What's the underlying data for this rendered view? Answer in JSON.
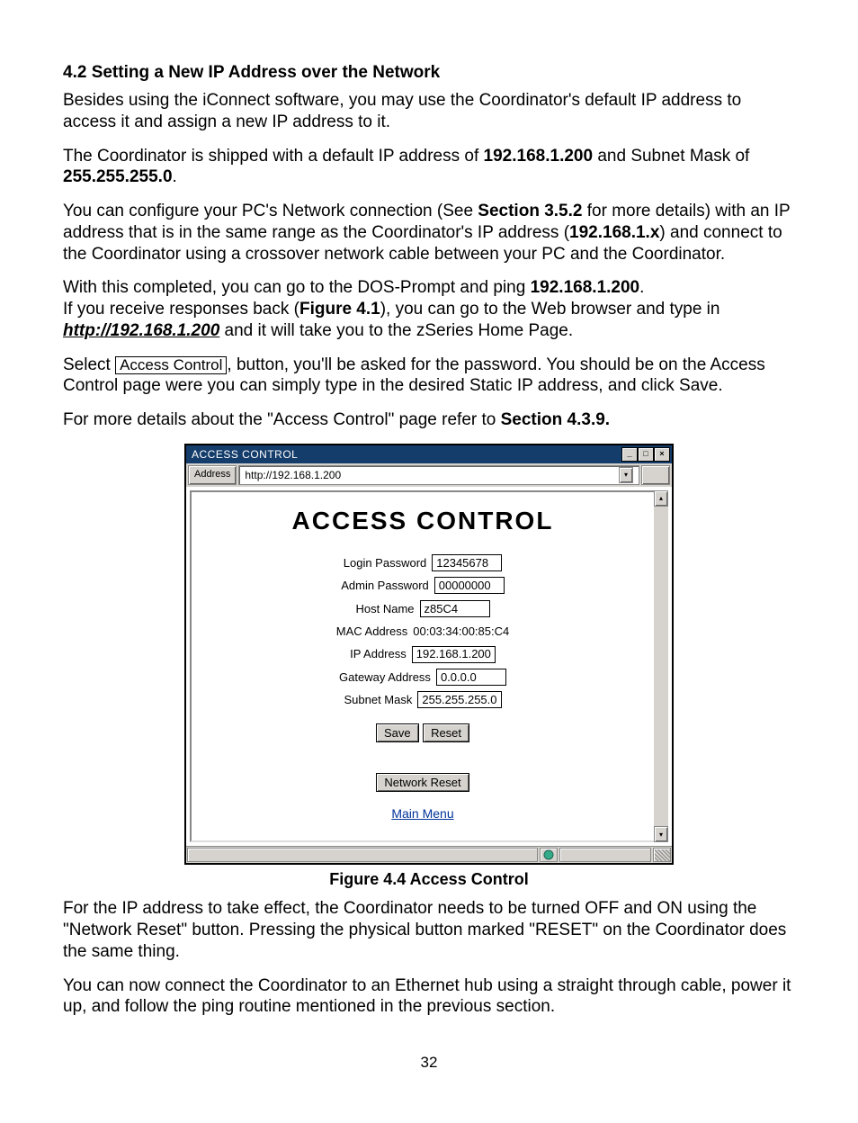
{
  "section_heading": "4.2 Setting a New IP Address over the Network",
  "para1": "Besides using the iConnect software, you may use the Coordinator's default IP address to access it and assign a new IP address to it.",
  "para2_pre": "The Coordinator is shipped with a default IP address of ",
  "para2_ip": "192.168.1.200",
  "para2_mid": " and Subnet Mask of ",
  "para2_mask": "255.255.255.0",
  "para2_end": ".",
  "para3_pre": "You can configure your PC's Network connection (See ",
  "para3_sec": "Section 3.5.2",
  "para3_mid": " for more details) with an IP address that is in the same range as the Coordinator's IP address (",
  "para3_range": "192.168.1.x",
  "para3_end": ") and connect to the Coordinator using a crossover network cable between your PC and the Coordinator.",
  "para4_line1_pre": "With this completed, you can go to the DOS-Prompt and ping ",
  "para4_line1_ip": "192.168.1.200",
  "para4_line1_end": ".",
  "para4_line2_pre": "If you receive responses back (",
  "para4_line2_fig": "Figure 4.1",
  "para4_line2_mid": "), you can go to the Web browser and type in ",
  "para4_url": "http://192.168.1.200",
  "para4_line2_end": " and it will take you to the zSeries Home Page.",
  "para5_pre": "Select  ",
  "para5_btn": "Access Control",
  "para5_post": ", button, you'll be asked for the password. You should be on the Access Control page were you can simply type in the desired Static IP address, and click Save.",
  "para6_pre": "For more details about the \"Access Control\" page refer to ",
  "para6_sec": "Section 4.3.9.",
  "window": {
    "title": "ACCESS CONTROL",
    "address_label": "Address",
    "address_value": "http://192.168.1.200",
    "heading": "ACCESS CONTROL",
    "fields": {
      "login_pw_label": "Login Password",
      "login_pw_value": "12345678",
      "admin_pw_label": "Admin Password",
      "admin_pw_value": "00000000",
      "host_label": "Host Name",
      "host_value": "z85C4",
      "mac_label": "MAC Address",
      "mac_value": "00:03:34:00:85:C4",
      "ip_label": "IP Address",
      "ip_value": "192.168.1.200",
      "gw_label": "Gateway Address",
      "gw_value": "0.0.0.0",
      "subnet_label": "Subnet Mask",
      "subnet_value": "255.255.255.0"
    },
    "buttons": {
      "save": "Save",
      "reset": "Reset",
      "net_reset": "Network Reset",
      "main_menu": "Main Menu"
    }
  },
  "figure_caption": "Figure 4.4  Access Control",
  "para7": "For the IP address to take effect, the Coordinator needs to be turned OFF and ON using the \"Network Reset\" button. Pressing the physical button marked \"RESET\" on the Coordinator does the same thing.",
  "para8": "You can now connect the Coordinator to an Ethernet hub using a straight through cable, power it up, and follow the ping routine mentioned in the previous section.",
  "page_number": "32"
}
